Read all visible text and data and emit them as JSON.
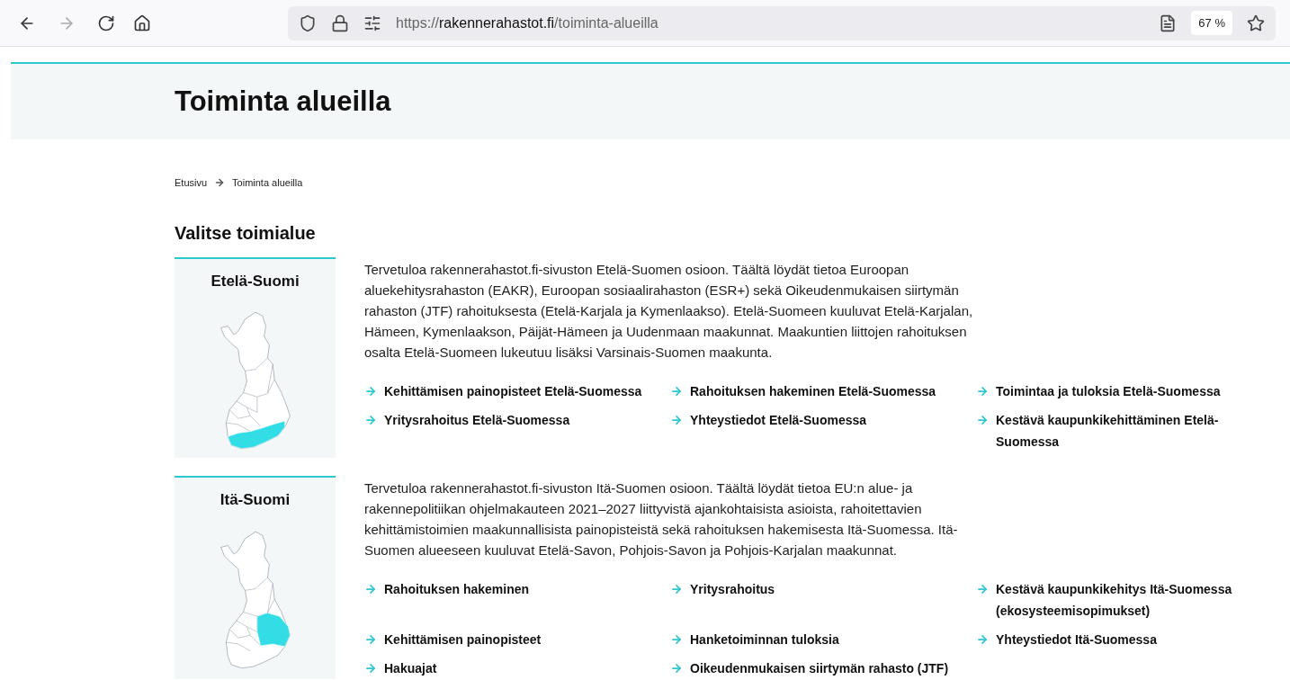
{
  "browser": {
    "url": {
      "scheme": "https://",
      "host": "rakennerahastot.fi",
      "path": "/toiminta-alueilla"
    },
    "zoom": "67 %"
  },
  "page_title": "Toiminta alueilla",
  "breadcrumbs": [
    "Etusivu",
    "Toiminta alueilla"
  ],
  "section_title": "Valitse toimialue",
  "regions": [
    {
      "name": "Etelä-Suomi",
      "kind": "south",
      "description": "Tervetuloa rakennerahastot.fi-sivuston Etelä-Suomen osioon. Täältä löydät tietoa Euroopan aluekehitysrahaston (EAKR), Euroopan sosiaalirahaston (ESR+) sekä Oikeudenmukaisen siirtymän rahaston (JTF) rahoituksesta (Etelä-Karjala ja Kymenlaakso). Etelä-Suomeen kuuluvat Etelä-Karjalan, Hämeen, Kymenlaakson, Päijät-Hämeen ja Uudenmaan maakunnat. Maakuntien liittojen rahoituksen osalta Etelä-Suomeen lukeutuu lisäksi Varsinais-Suomen maakunta.",
      "links": [
        "Kehittämisen painopisteet Etelä-Suomessa",
        "Rahoituksen hakeminen Etelä-Suomessa",
        "Toimintaa ja tuloksia Etelä-Suomessa",
        "Yritysrahoitus Etelä-Suomessa",
        "Yhteystiedot Etelä-Suomessa",
        "Kestävä kaupunkikehittäminen Etelä-Suomessa"
      ]
    },
    {
      "name": "Itä-Suomi",
      "kind": "east",
      "description": "Tervetuloa rakennerahastot.fi-sivuston Itä-Suomen osioon. Täältä löydät tietoa EU:n alue- ja rakennepolitiikan ohjelmakauteen 2021–2027 liittyvistä ajankohtaisista asioista, rahoitettavien kehittämistoimien maakunnallisista painopisteistä sekä rahoituksen hakemisesta Itä-Suomessa. Itä-Suomen alueeseen kuuluvat Etelä-Savon, Pohjois-Savon ja Pohjois-Karjalan maakunnat.",
      "links": [
        "Rahoituksen hakeminen",
        "Yritysrahoitus",
        "Kestävä kaupunkikehitys Itä-Suomessa (ekosysteemisopimukset)",
        "Kehittämisen painopisteet",
        "Hanketoiminnan tuloksia",
        "Yhteystiedot Itä-Suomessa",
        "Hakuajat",
        "Oikeudenmukaisen siirtymän rahasto (JTF)"
      ]
    }
  ]
}
